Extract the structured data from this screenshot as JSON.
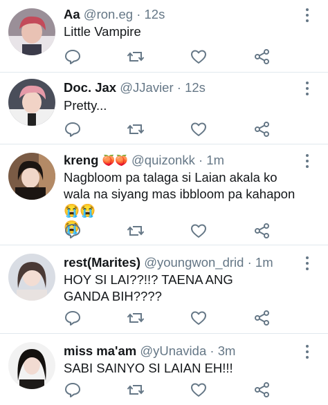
{
  "tweets": [
    {
      "name": "Aa",
      "handle": "@ron.eg",
      "sep": "·",
      "time": "12s",
      "text": "Little Vampire",
      "badge": ""
    },
    {
      "name": "Doc. Jax",
      "handle": "@JJavier",
      "sep": "·",
      "time": "12s",
      "text": "Pretty...",
      "badge": ""
    },
    {
      "name": "kreng",
      "handle": "@quizonkk",
      "sep": "·",
      "time": "1m",
      "text": "Nagbloom pa talaga si Laian akala ko wala na siyang mas ibbloom pa kahapon 😭😭\n😭",
      "badge": "🍑🍑"
    },
    {
      "name": "rest(Marites)",
      "handle": "@youngwon_drid",
      "sep": "·",
      "time": "1m",
      "text": "HOY SI LAI??!!? TAENA ANG GANDA BIH????",
      "badge": ""
    },
    {
      "name": "miss ma'am",
      "handle": "@yUnavida",
      "sep": "·",
      "time": "3m",
      "text": "SABI SAINYO SI LAIAN EH!!!",
      "badge": ""
    }
  ],
  "icons": {
    "reply": "reply-icon",
    "retweet": "retweet-icon",
    "like": "heart-icon",
    "share": "share-icon",
    "more": "more-vertical-icon"
  },
  "colors": {
    "text": "#14171a",
    "secondary": "#657786",
    "separator": "#e1e8ed",
    "background": "#ffffff"
  }
}
